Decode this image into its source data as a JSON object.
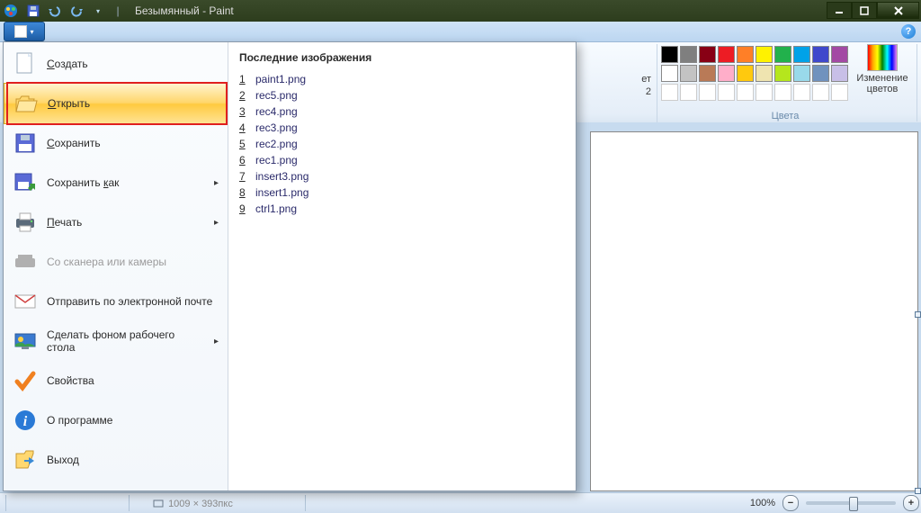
{
  "window": {
    "title": "Безымянный - Paint"
  },
  "qat": {
    "save": "save-icon",
    "undo": "undo-icon",
    "redo": "redo-icon"
  },
  "help_label": "?",
  "ribbon": {
    "partial_text1": "ет",
    "partial_text2": "2",
    "colors_group": "Цвета",
    "edit_colors_l1": "Изменение",
    "edit_colors_l2": "цветов",
    "row1": [
      "#000000",
      "#7f7f7f",
      "#880015",
      "#ed1c24",
      "#ff7f27",
      "#fff200",
      "#22b14c",
      "#00a2e8",
      "#3f48cc",
      "#a349a4"
    ],
    "row2": [
      "#ffffff",
      "#c3c3c3",
      "#b97a57",
      "#ffaec9",
      "#ffc90e",
      "#efe4b0",
      "#b5e61d",
      "#99d9ea",
      "#7092be",
      "#c8bfe7"
    ]
  },
  "menu": {
    "items": [
      {
        "label": "Создать",
        "u": "С",
        "icon": "blank-page",
        "arrow": false
      },
      {
        "label": "Открыть",
        "u": "О",
        "icon": "open-folder",
        "arrow": false,
        "selected": true
      },
      {
        "label": "Сохранить",
        "u": "С",
        "icon": "floppy",
        "arrow": false
      },
      {
        "label": "Сохранить как",
        "u": "к",
        "icon": "floppy-as",
        "arrow": true
      },
      {
        "label": "Печать",
        "u": "П",
        "icon": "printer",
        "arrow": true
      },
      {
        "label": "Со сканера или камеры",
        "u": "",
        "icon": "scanner",
        "arrow": false,
        "disabled": true
      },
      {
        "label": "Отправить по электронной почте",
        "u": "",
        "icon": "mail",
        "arrow": false
      },
      {
        "label": "Сделать фоном рабочего стола",
        "u": "",
        "icon": "desktop",
        "arrow": true
      },
      {
        "label": "Свойства",
        "u": "",
        "icon": "check",
        "arrow": false
      },
      {
        "label": "О программе",
        "u": "",
        "icon": "info",
        "arrow": false
      },
      {
        "label": "Выход",
        "u": "",
        "icon": "exit",
        "arrow": false
      }
    ],
    "recent_header": "Последние изображения",
    "recent": [
      {
        "n": "1",
        "name": "paint1.png"
      },
      {
        "n": "2",
        "name": "rec5.png"
      },
      {
        "n": "3",
        "name": "rec4.png"
      },
      {
        "n": "4",
        "name": "rec3.png"
      },
      {
        "n": "5",
        "name": "rec2.png"
      },
      {
        "n": "6",
        "name": "rec1.png"
      },
      {
        "n": "7",
        "name": "insert3.png"
      },
      {
        "n": "8",
        "name": "insert1.png"
      },
      {
        "n": "9",
        "name": "ctrl1.png"
      }
    ]
  },
  "status": {
    "dims_mask": "1009 × 393пкс",
    "zoom": "100%"
  }
}
